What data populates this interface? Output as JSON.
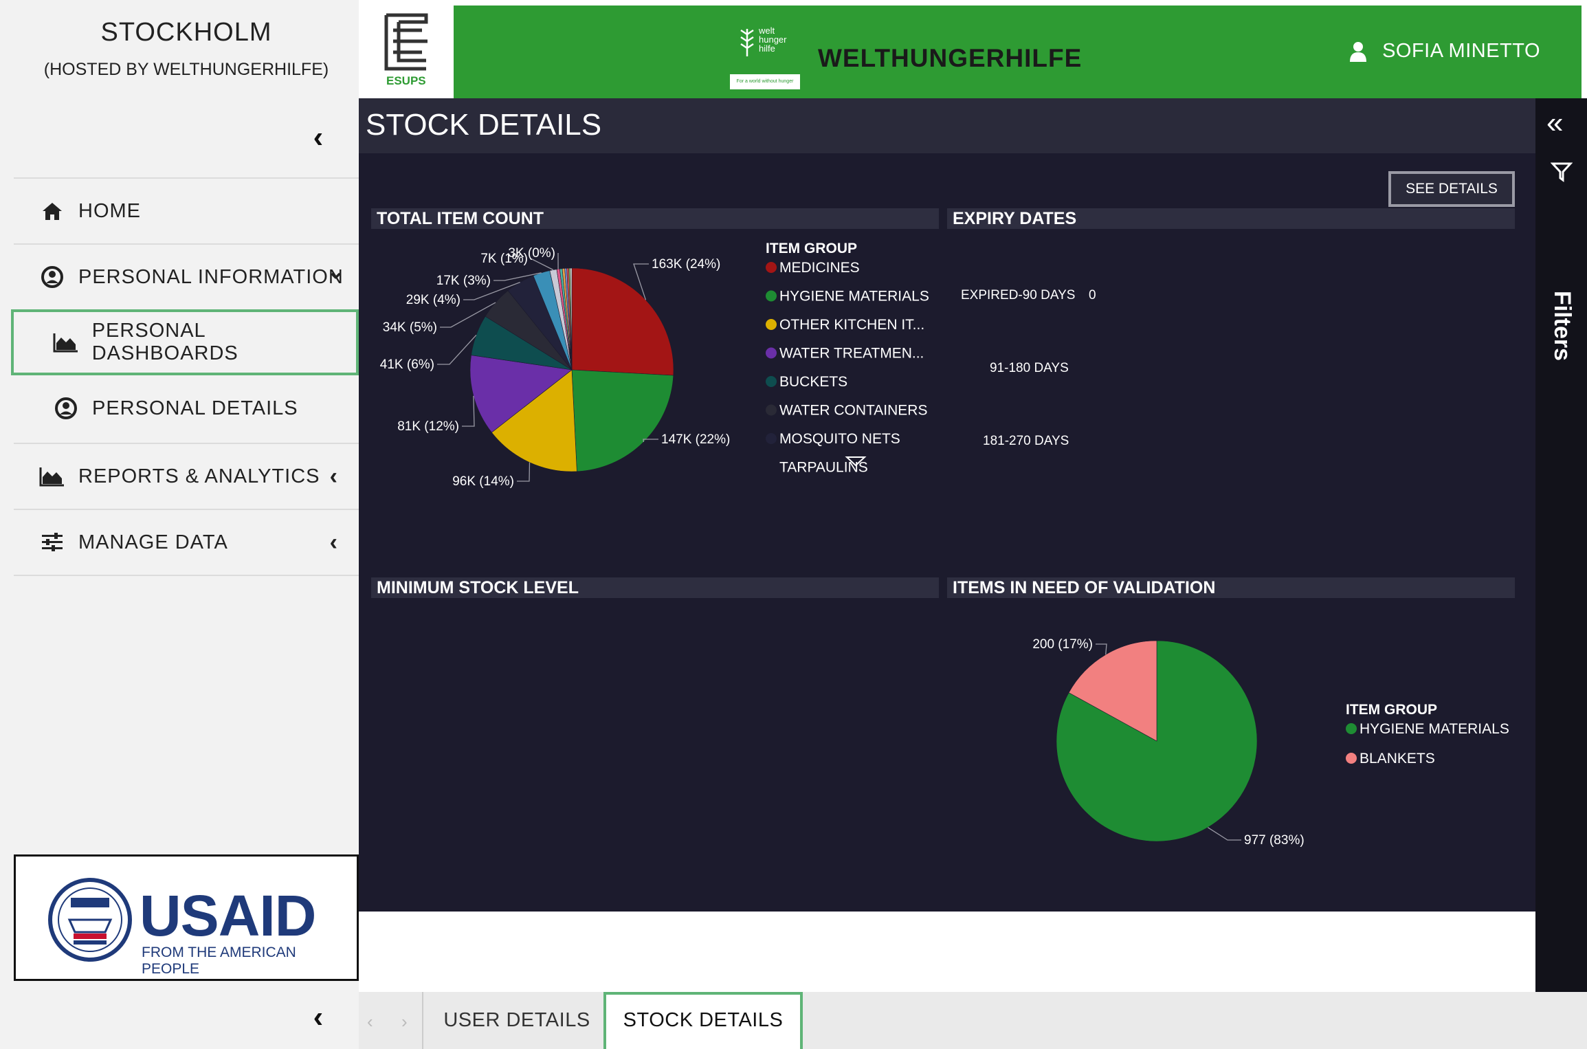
{
  "sidebar": {
    "org_name": "STOCKHOLM",
    "org_host": "(HOSTED BY WELTHUNGERHILFE)",
    "nav": [
      {
        "label": "HOME",
        "icon": "home-icon"
      },
      {
        "label": "PERSONAL INFORMATION",
        "icon": "user-circle-icon"
      },
      {
        "label": "PERSONAL DASHBOARDS",
        "icon": "area-chart-icon"
      },
      {
        "label": "PERSONAL DETAILS",
        "icon": "user-circle-icon"
      },
      {
        "label": "REPORTS & ANALYTICS",
        "icon": "area-chart-icon"
      },
      {
        "label": "MANAGE DATA",
        "icon": "sliders-icon"
      }
    ],
    "usaid": {
      "wordmark": "USAID",
      "tagline": "FROM THE AMERICAN PEOPLE"
    }
  },
  "header": {
    "esups_label": "ESUPS",
    "partner_logo_text": [
      "welt",
      "hunger",
      "hilfe"
    ],
    "partner_logo_tagline": "For a world without hunger",
    "partner_name": "WELTHUNGERHILFE",
    "user_name": "SOFIA MINETTO",
    "colors": {
      "brand_green": "#2e9b33"
    }
  },
  "report": {
    "title": "STOCK DETAILS",
    "see_details": "SEE DETAILS",
    "total_item_count": {
      "header": "TOTAL ITEM COUNT",
      "legend_title": "ITEM GROUP",
      "legend": [
        {
          "name": "MEDICINES",
          "color": "#a31515"
        },
        {
          "name": "HYGIENE MATERIALS",
          "color": "#1e8c33"
        },
        {
          "name": "OTHER KITCHEN IT...",
          "color": "#dcb000"
        },
        {
          "name": "WATER TREATMEN...",
          "color": "#6a2fa8"
        },
        {
          "name": "BUCKETS",
          "color": "#0e4d4f"
        },
        {
          "name": "WATER CONTAINERS",
          "color": "#2a2a36"
        },
        {
          "name": "MOSQUITO NETS",
          "color": "#22223a"
        },
        {
          "name": "TARPAULINS",
          "color": ""
        }
      ]
    },
    "expiry_dates": {
      "header": "EXPIRY DATES",
      "rows": [
        {
          "label": "EXPIRED-90 DAYS",
          "value": "0"
        },
        {
          "label": "91-180 DAYS",
          "value": ""
        },
        {
          "label": "181-270 DAYS",
          "value": ""
        }
      ]
    },
    "minimum_stock_level": {
      "header": "MINIMUM STOCK LEVEL"
    },
    "items_need_validation": {
      "header": "ITEMS IN NEED OF VALIDATION",
      "legend_title": "ITEM GROUP",
      "legend": [
        {
          "name": "HYGIENE MATERIALS",
          "color": "#1e8c33"
        },
        {
          "name": "BLANKETS",
          "color": "#f28080"
        }
      ]
    }
  },
  "filters": {
    "label": "Filters"
  },
  "tabs": [
    {
      "label": "USER DETAILS"
    },
    {
      "label": "STOCK DETAILS"
    }
  ],
  "chart_data": [
    {
      "type": "pie",
      "title": "TOTAL ITEM COUNT",
      "legend_title": "ITEM GROUP",
      "slices": [
        {
          "label": "MEDICINES",
          "value": 163000,
          "display": "163K (24%)",
          "color": "#a31515"
        },
        {
          "label": "HYGIENE MATERIALS",
          "value": 147000,
          "display": "147K (22%)",
          "color": "#1e8c33"
        },
        {
          "label": "OTHER KITCHEN IT...",
          "value": 96000,
          "display": "96K (14%)",
          "color": "#dcb000"
        },
        {
          "label": "WATER TREATMEN...",
          "value": 81000,
          "display": "81K (12%)",
          "color": "#6a2fa8"
        },
        {
          "label": "BUCKETS",
          "value": 41000,
          "display": "41K (6%)",
          "color": "#0e4d4f"
        },
        {
          "label": "WATER CONTAINERS",
          "value": 34000,
          "display": "34K (5%)",
          "color": "#2a2a36"
        },
        {
          "label": "MOSQUITO NETS",
          "value": 29000,
          "display": "29K (4%)",
          "color": "#22223a"
        },
        {
          "label": "",
          "value": 17000,
          "display": "17K (3%)",
          "color": "#3a8fb7"
        },
        {
          "label": "",
          "value": 7000,
          "display": "7K (1%)",
          "color": "#c9c9d6"
        },
        {
          "label": "",
          "value": 3000,
          "display": "3K (0%)",
          "color": "#e05a8a"
        },
        {
          "label": "",
          "value": 2500,
          "display": "",
          "color": "#4bb3a4"
        },
        {
          "label": "",
          "value": 2500,
          "display": "",
          "color": "#e8a04a"
        },
        {
          "label": "",
          "value": 2000,
          "display": "",
          "color": "#7f8fd6"
        },
        {
          "label": "",
          "value": 2000,
          "display": "",
          "color": "#d45050"
        },
        {
          "label": "",
          "value": 1500,
          "display": "",
          "color": "#8fc46a"
        },
        {
          "label": "",
          "value": 1500,
          "display": "",
          "color": "#f2f2f2"
        }
      ]
    },
    {
      "type": "pie",
      "title": "ITEMS IN NEED OF VALIDATION",
      "legend_title": "ITEM GROUP",
      "slices": [
        {
          "label": "HYGIENE MATERIALS",
          "value": 977,
          "display": "977 (83%)",
          "color": "#1e8c33"
        },
        {
          "label": "BLANKETS",
          "value": 200,
          "display": "200 (17%)",
          "color": "#f28080"
        }
      ]
    }
  ]
}
